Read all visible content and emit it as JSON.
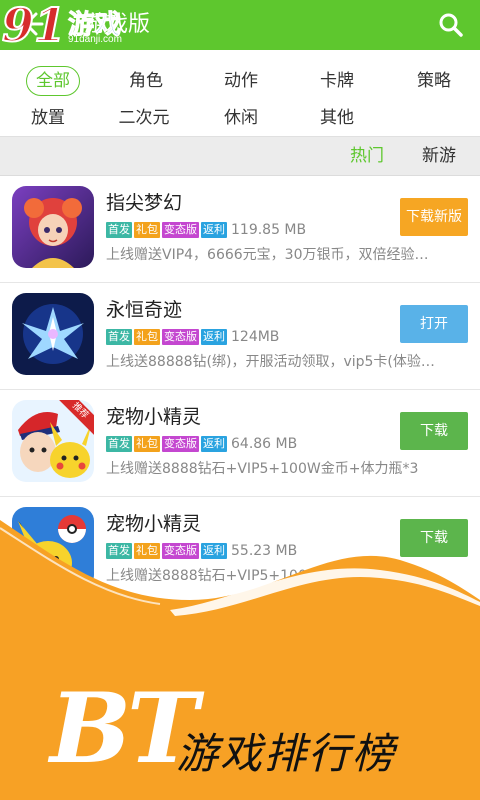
{
  "watermark": {
    "brand_num": "91",
    "brand_text": "游戏",
    "url": "91danji.com"
  },
  "header": {
    "back_icon": "arrow-left-icon",
    "title": "游戏版",
    "search_icon": "search-icon"
  },
  "categories": [
    {
      "label": "全部",
      "active": true
    },
    {
      "label": "角色"
    },
    {
      "label": "动作"
    },
    {
      "label": "卡牌"
    },
    {
      "label": "策略"
    },
    {
      "label": "放置"
    },
    {
      "label": "二次元"
    },
    {
      "label": "休闲"
    },
    {
      "label": "其他"
    }
  ],
  "sort": {
    "hot": "热门",
    "new": "新游"
  },
  "tags": {
    "first": "首发",
    "gift": "礼包",
    "variant": "变态版",
    "rebate": "返利"
  },
  "apps": [
    {
      "name": "指尖梦幻",
      "size": "119.85 MB",
      "desc": "上线赠送VIP4，6666元宝，30万银币，双倍经验…",
      "button": "下载新版"
    },
    {
      "name": "永恒奇迹",
      "size": "124MB",
      "desc": "上线送88888钻(绑)，开服活动领取，vip5卡(体验…",
      "button": "打开"
    },
    {
      "name": "宠物小精灵",
      "size": "64.86 MB",
      "desc": "上线赠送8888钻石+VIP5+100W金币+体力瓶*3",
      "button": "下载",
      "badge": "推荐"
    },
    {
      "name": "宠物小精灵",
      "size": "55.23 MB",
      "desc": "上线赠送8888钻石+VIP5+100W金币+体",
      "button": "下载"
    }
  ],
  "promo": {
    "big": "BT",
    "caption": "游戏排行榜"
  },
  "colors": {
    "green": "#5ec72e",
    "orange": "#f6a623",
    "banner": "#f7a125"
  }
}
